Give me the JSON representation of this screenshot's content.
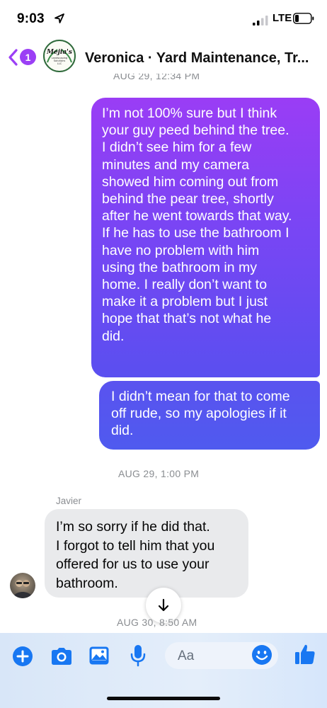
{
  "status_bar": {
    "time": "9:03",
    "network": "LTE"
  },
  "nav": {
    "back_badge": "1",
    "title": "Veronica · Yard Maintenance, Tr...",
    "logo_name": "Mejia's",
    "logo_line1": "Landscaping",
    "logo_line2": "Solutions",
    "logo_line3": "LLC"
  },
  "messages": {
    "timestamp_top": "AUG 29, 12:34 PM",
    "outgoing_1_lines": [
      "I’m not 100% sure but I think",
      "your guy peed behind the tree.",
      "I didn’t see him for a few",
      "minutes and my camera",
      "showed him coming out from",
      "behind the pear tree, shortly",
      "after he went towards that way.",
      "If he has to use the bathroom I",
      "have no problem with him",
      "using the bathroom in my",
      "home.  I really don’t want to",
      "make it a problem but I just",
      "hope that that’s not what he",
      "did."
    ],
    "outgoing_2_lines": [
      "I didn’t mean for that to come",
      "off rude, so my apologies if it",
      "did."
    ],
    "timestamp_mid": "AUG 29, 1:00 PM",
    "sender": "Javier",
    "incoming_1_lines": [
      "I’m so sorry if he did that.",
      "I  forgot to tell him that you",
      "offered for us to use your",
      "bathroom."
    ],
    "timestamp_bottom": "AUG 30, 8:50 AM"
  },
  "composer": {
    "placeholder": "Aa"
  },
  "colors": {
    "accent_purple": "#9b3ff5",
    "accent_blue": "#1877f2",
    "bubble_gradient_top": "#9a3df5",
    "bubble_gradient_bottom": "#4f5aef",
    "incoming_bubble": "#e9eaec"
  },
  "icons": [
    "location-arrow-icon",
    "signal-icon",
    "battery-icon",
    "chevron-left-icon",
    "plus-icon",
    "camera-icon",
    "gallery-icon",
    "mic-icon",
    "emoji-icon",
    "like-icon",
    "arrow-down-icon"
  ]
}
